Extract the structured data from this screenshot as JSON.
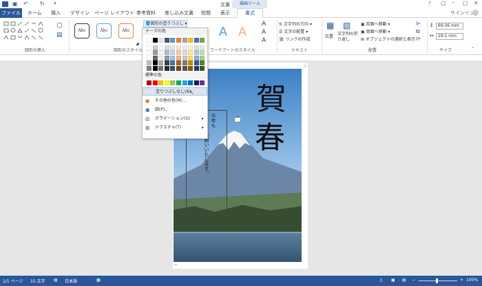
{
  "window": {
    "title": "文書 1 - Word",
    "signin": "サインイン",
    "tool_context": "描画ツール"
  },
  "tabs": [
    "ファイル",
    "ホーム",
    "挿入",
    "デザイン",
    "ページ レイアウト",
    "参考資料",
    "差し込み文書",
    "校閲",
    "表示",
    "書式"
  ],
  "ribbon": {
    "group_insert_shapes": "図形の挿入",
    "group_shape_styles": "図形のスタイル",
    "group_wordart": "ワードアートのスタイル",
    "group_text": "テキスト",
    "group_arrange": "配置",
    "group_size": "サイズ",
    "style_labels": [
      "Abc",
      "Abc",
      "Abc"
    ],
    "wordart_letters": [
      "A",
      "A"
    ],
    "text_direction": "文字列の方向",
    "align_text": "文字の配置",
    "create_link": "リンクの作成",
    "position": "位置",
    "wrap_text": "文字列の折り返し",
    "bring_forward": "前面へ移動",
    "send_backward": "背面へ移動",
    "selection_pane": "オブジェクトの選択と表示",
    "height_value": "69.06 mm",
    "width_value": "29.1 mm"
  },
  "dropdown": {
    "button_label": "図形の塗りつぶし",
    "theme_colors_label": "テーマの色",
    "standard_colors_label": "標準の色",
    "no_fill": "塗りつぶしなし(N)",
    "more_colors": "その他の色(M)...",
    "picture": "図(P)...",
    "gradient": "グラデーション(G)",
    "texture": "テクスチャ(T)",
    "theme_colors": [
      "#ffffff",
      "#000000",
      "#e7e6e6",
      "#44546a",
      "#5b9bd5",
      "#ed7d31",
      "#a5a5a5",
      "#ffc000",
      "#4472c4",
      "#70ad47"
    ],
    "standard_colors": [
      "#c00000",
      "#ff0000",
      "#ffc000",
      "#ffff00",
      "#92d050",
      "#00b050",
      "#00b0f0",
      "#0070c0",
      "#002060",
      "#7030a0"
    ]
  },
  "document": {
    "vertical_text_line1": "今年も",
    "vertical_text_line2": "よろしくお願いいたします。",
    "calligraphy_1": "賀",
    "calligraphy_2": "春"
  },
  "status": {
    "page": "1/1 ページ",
    "words": "15 文字",
    "language": "日本語",
    "zoom": "100%"
  }
}
